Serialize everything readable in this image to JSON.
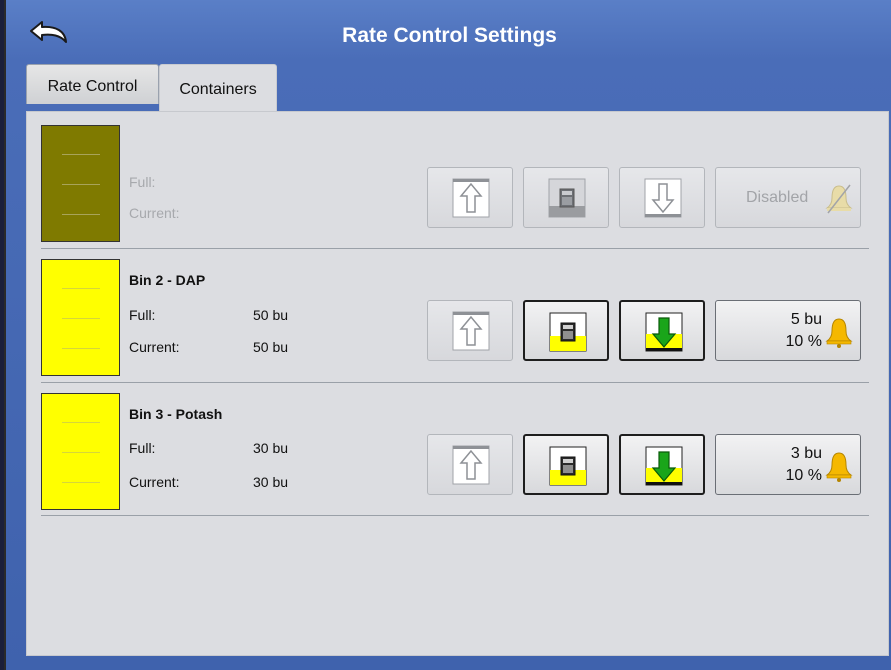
{
  "header": {
    "title": "Rate Control Settings"
  },
  "tabs": [
    {
      "label": "Rate Control"
    },
    {
      "label": "Containers"
    }
  ],
  "bins": [
    {
      "name": "",
      "full_label": "Full:",
      "full_value": "",
      "current_label": "Current:",
      "current_value": "",
      "color": "#7f7a00",
      "alarm": {
        "status": "Disabled"
      }
    },
    {
      "name": "Bin 2 - DAP",
      "full_label": "Full:",
      "full_value": "50 bu",
      "current_label": "Current:",
      "current_value": "50 bu",
      "color": "#ffff00",
      "alarm": {
        "amount": "5 bu",
        "percent": "10 %"
      }
    },
    {
      "name": "Bin 3 - Potash",
      "full_label": "Full:",
      "full_value": "30 bu",
      "current_label": "Current:",
      "current_value": "30 bu",
      "color": "#ffff00",
      "alarm": {
        "amount": "3 bu",
        "percent": "10 %"
      }
    }
  ],
  "colors": {
    "title_bar": "#4a6db8",
    "panel": "#dcdde1",
    "fill_arrow": "#1aa51a",
    "bell": "#f5b800"
  }
}
